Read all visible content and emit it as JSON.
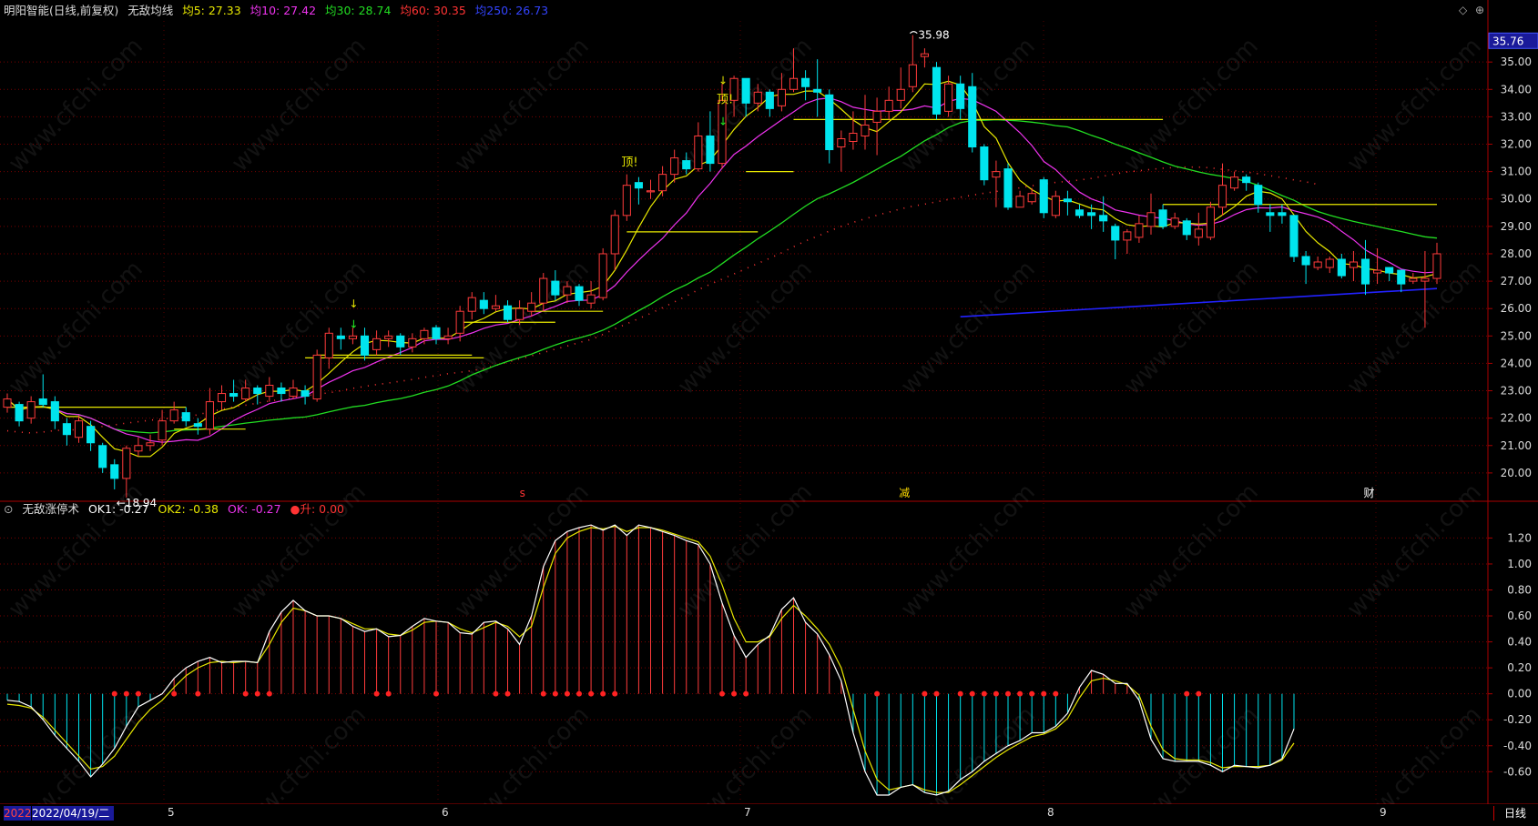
{
  "main_header": {
    "title": "明阳智能(日线,前复权)",
    "indicator": "无敌均线",
    "ma5": "均5: 27.33",
    "ma10": "均10: 27.42",
    "ma30": "均30: 28.74",
    "ma60": "均60: 30.35",
    "ma250": "均250: 26.73"
  },
  "sub_header": {
    "indicator": "无敌涨停术",
    "ok1": "OK1: -0.27",
    "ok2": "OK2: -0.38",
    "ok": "OK: -0.27",
    "rise": "●升: 0.00"
  },
  "price_axis": {
    "current_price": "35.76",
    "ticks": [
      "35.00",
      "34.00",
      "33.00",
      "32.00",
      "31.00",
      "30.00",
      "29.00",
      "28.00",
      "27.00",
      "26.00",
      "25.00",
      "24.00",
      "23.00",
      "22.00",
      "21.00",
      "20.00"
    ]
  },
  "osc_axis": {
    "ticks": [
      "1.20",
      "1.00",
      "0.80",
      "0.60",
      "0.40",
      "0.20",
      "0.00",
      "-0.20",
      "-0.40",
      "-0.60"
    ]
  },
  "annotations": {
    "high_label": "35.98",
    "low_label": "←18.94",
    "top_signal_1": "顶!",
    "top_signal_2": "顶!",
    "marker_s": "s",
    "marker_reduce": "减",
    "marker_fin": "财"
  },
  "bottom_bar": {
    "year_fragment": "2022",
    "cursor_date": "2022/04/19/二",
    "months": [
      "5",
      "6",
      "7",
      "8",
      "9"
    ],
    "period": "日线"
  },
  "watermark": "www.cfchi.com",
  "colors": {
    "up": "#ff3b3b",
    "down": "#00e5ee",
    "ma5": "#e8e800",
    "ma10": "#ee33ee",
    "ma30": "#22dd22",
    "ma60": "#ff3333",
    "ma250": "#2222ff",
    "grid": "#7a0000"
  },
  "chart_data": [
    {
      "type": "candlestick",
      "title": "明阳智能(日线,前复权)",
      "series": [
        {
          "name": "均5",
          "last": 27.33
        },
        {
          "name": "均10",
          "last": 27.42
        },
        {
          "name": "均30",
          "last": 28.74
        },
        {
          "name": "均60",
          "last": 30.35
        },
        {
          "name": "均250",
          "last": 26.73
        }
      ],
      "ylim": [
        19.0,
        36.5
      ],
      "high": 35.98,
      "low": 18.94,
      "candles": [
        [
          22.4,
          22.7,
          22.2,
          22.9
        ],
        [
          22.5,
          21.9,
          21.7,
          22.6
        ],
        [
          22.0,
          22.6,
          21.8,
          22.8
        ],
        [
          22.7,
          22.5,
          22.4,
          23.6
        ],
        [
          22.6,
          21.9,
          21.6,
          22.8
        ],
        [
          21.8,
          21.4,
          21.0,
          22.0
        ],
        [
          21.3,
          21.9,
          21.1,
          22.1
        ],
        [
          21.7,
          21.1,
          20.8,
          21.9
        ],
        [
          21.0,
          20.2,
          20.0,
          21.1
        ],
        [
          20.3,
          19.8,
          19.4,
          20.5
        ],
        [
          19.8,
          20.9,
          19.1,
          21.0
        ],
        [
          20.8,
          21.0,
          20.6,
          21.3
        ],
        [
          21.0,
          21.1,
          20.8,
          21.4
        ],
        [
          21.2,
          21.9,
          21.0,
          22.3
        ],
        [
          21.9,
          22.3,
          21.8,
          22.6
        ],
        [
          22.2,
          21.9,
          21.7,
          22.4
        ],
        [
          21.8,
          21.7,
          21.4,
          22.0
        ],
        [
          21.6,
          22.6,
          21.4,
          23.1
        ],
        [
          22.6,
          22.9,
          22.3,
          23.2
        ],
        [
          22.9,
          22.8,
          22.6,
          23.4
        ],
        [
          22.7,
          23.1,
          22.6,
          23.4
        ],
        [
          23.1,
          22.9,
          22.5,
          23.2
        ],
        [
          22.8,
          23.2,
          22.6,
          23.5
        ],
        [
          23.1,
          22.9,
          22.6,
          23.3
        ],
        [
          22.8,
          23.1,
          22.7,
          23.4
        ],
        [
          23.0,
          22.8,
          22.5,
          23.2
        ],
        [
          22.7,
          24.3,
          22.6,
          24.5
        ],
        [
          24.2,
          25.1,
          23.8,
          25.3
        ],
        [
          25.0,
          24.9,
          24.5,
          25.3
        ],
        [
          24.9,
          25.0,
          24.7,
          25.3
        ],
        [
          25.0,
          24.3,
          24.1,
          25.3
        ],
        [
          24.5,
          24.9,
          24.3,
          25.2
        ],
        [
          24.9,
          25.0,
          24.6,
          25.2
        ],
        [
          25.0,
          24.6,
          24.3,
          25.1
        ],
        [
          24.6,
          24.9,
          24.4,
          25.1
        ],
        [
          24.9,
          25.2,
          24.7,
          25.3
        ],
        [
          25.3,
          24.9,
          24.7,
          25.4
        ],
        [
          24.9,
          25.0,
          24.7,
          25.3
        ],
        [
          25.1,
          25.9,
          24.8,
          26.1
        ],
        [
          25.9,
          26.4,
          25.6,
          26.6
        ],
        [
          26.3,
          26.0,
          25.8,
          26.6
        ],
        [
          26.0,
          26.1,
          25.9,
          26.5
        ],
        [
          26.1,
          25.6,
          25.5,
          26.3
        ],
        [
          25.6,
          26.0,
          25.4,
          26.3
        ],
        [
          25.9,
          26.2,
          25.7,
          26.6
        ],
        [
          26.2,
          27.1,
          25.9,
          27.3
        ],
        [
          27.0,
          26.5,
          26.3,
          27.4
        ],
        [
          26.5,
          26.8,
          26.2,
          27.0
        ],
        [
          26.8,
          26.3,
          26.1,
          26.9
        ],
        [
          26.2,
          26.5,
          26.0,
          27.0
        ],
        [
          26.4,
          28.0,
          26.3,
          28.2
        ],
        [
          28.0,
          29.4,
          27.4,
          29.6
        ],
        [
          29.4,
          30.5,
          29.2,
          30.9
        ],
        [
          30.6,
          30.4,
          29.8,
          30.8
        ],
        [
          30.3,
          30.3,
          30.0,
          30.7
        ],
        [
          30.3,
          30.9,
          30.1,
          31.2
        ],
        [
          30.9,
          31.5,
          30.6,
          31.8
        ],
        [
          31.4,
          31.1,
          30.9,
          31.7
        ],
        [
          31.1,
          32.3,
          31.0,
          32.8
        ],
        [
          32.3,
          31.3,
          31.0,
          33.2
        ],
        [
          31.3,
          33.6,
          31.1,
          34.2
        ],
        [
          33.6,
          34.4,
          33.0,
          34.5
        ],
        [
          34.4,
          33.5,
          33.0,
          34.4
        ],
        [
          33.5,
          33.9,
          33.2,
          34.2
        ],
        [
          33.9,
          33.3,
          33.0,
          34.0
        ],
        [
          33.4,
          34.0,
          33.2,
          34.6
        ],
        [
          34.0,
          34.4,
          33.9,
          35.5
        ],
        [
          34.4,
          34.1,
          33.6,
          34.7
        ],
        [
          34.0,
          33.9,
          33.0,
          35.1
        ],
        [
          33.8,
          31.8,
          31.3,
          34.0
        ],
        [
          31.9,
          32.2,
          31.0,
          32.5
        ],
        [
          32.1,
          32.4,
          31.8,
          33.2
        ],
        [
          32.3,
          32.7,
          31.8,
          33.8
        ],
        [
          32.8,
          33.2,
          31.6,
          33.7
        ],
        [
          33.2,
          33.6,
          32.9,
          34.1
        ],
        [
          33.6,
          34.0,
          33.3,
          34.8
        ],
        [
          34.1,
          34.9,
          33.9,
          35.98
        ],
        [
          35.2,
          35.3,
          34.8,
          35.5
        ],
        [
          34.8,
          33.1,
          32.9,
          35.0
        ],
        [
          33.2,
          34.2,
          33.0,
          34.5
        ],
        [
          34.2,
          33.3,
          32.9,
          34.5
        ],
        [
          34.1,
          31.9,
          31.7,
          34.6
        ],
        [
          31.9,
          30.7,
          30.5,
          32.0
        ],
        [
          30.8,
          31.0,
          29.7,
          31.4
        ],
        [
          31.1,
          29.7,
          29.6,
          31.3
        ],
        [
          29.7,
          30.1,
          29.7,
          30.3
        ],
        [
          29.9,
          30.2,
          29.8,
          30.4
        ],
        [
          30.7,
          29.5,
          29.3,
          30.8
        ],
        [
          29.4,
          30.1,
          29.3,
          30.3
        ],
        [
          30.0,
          29.9,
          29.4,
          30.3
        ],
        [
          29.6,
          29.4,
          29.3,
          29.8
        ],
        [
          29.5,
          29.4,
          28.9,
          29.8
        ],
        [
          29.4,
          29.2,
          28.8,
          30.1
        ],
        [
          29.0,
          28.5,
          27.8,
          29.1
        ],
        [
          28.5,
          28.8,
          28.0,
          28.9
        ],
        [
          28.6,
          29.1,
          28.4,
          29.4
        ],
        [
          29.0,
          29.5,
          28.7,
          30.2
        ],
        [
          29.6,
          29.0,
          28.9,
          29.8
        ],
        [
          29.0,
          29.3,
          28.9,
          29.5
        ],
        [
          29.2,
          28.7,
          28.5,
          29.3
        ],
        [
          28.6,
          28.9,
          28.3,
          29.5
        ],
        [
          28.6,
          29.7,
          28.5,
          29.9
        ],
        [
          29.7,
          30.5,
          29.4,
          31.3
        ],
        [
          30.4,
          30.8,
          30.3,
          31.0
        ],
        [
          30.8,
          30.6,
          30.3,
          30.9
        ],
        [
          30.5,
          29.8,
          29.5,
          30.6
        ],
        [
          29.5,
          29.4,
          28.8,
          29.8
        ],
        [
          29.5,
          29.4,
          29.1,
          29.8
        ],
        [
          29.4,
          27.9,
          27.7,
          29.4
        ],
        [
          27.9,
          27.6,
          26.9,
          28.1
        ],
        [
          27.5,
          27.7,
          27.4,
          27.9
        ],
        [
          27.5,
          27.8,
          27.3,
          27.9
        ],
        [
          27.8,
          27.2,
          27.1,
          28.0
        ],
        [
          27.5,
          27.7,
          27.0,
          28.1
        ],
        [
          27.8,
          26.9,
          26.5,
          28.5
        ],
        [
          27.3,
          27.4,
          26.9,
          28.2
        ],
        [
          27.5,
          27.3,
          27.0,
          27.5
        ],
        [
          27.4,
          26.9,
          26.6,
          27.4
        ],
        [
          27.0,
          27.1,
          26.9,
          27.3
        ],
        [
          27.0,
          27.1,
          25.3,
          28.1
        ],
        [
          27.1,
          28.0,
          26.9,
          28.4
        ]
      ]
    },
    {
      "type": "line",
      "title": "无敌涨停术",
      "series": [
        {
          "name": "OK1",
          "last": -0.27
        },
        {
          "name": "OK2",
          "last": -0.38
        },
        {
          "name": "OK",
          "last": -0.27
        },
        {
          "name": "升",
          "last": 0.0
        }
      ],
      "ylim": [
        -0.85,
        1.35
      ],
      "ok": [
        -0.05,
        -0.06,
        -0.1,
        -0.2,
        -0.32,
        -0.42,
        -0.52,
        -0.64,
        -0.54,
        -0.42,
        -0.25,
        -0.1,
        -0.05,
        0.0,
        0.12,
        0.2,
        0.25,
        0.28,
        0.24,
        0.25,
        0.25,
        0.24,
        0.48,
        0.63,
        0.72,
        0.64,
        0.6,
        0.6,
        0.58,
        0.52,
        0.48,
        0.5,
        0.44,
        0.45,
        0.52,
        0.58,
        0.56,
        0.55,
        0.47,
        0.46,
        0.55,
        0.56,
        0.5,
        0.38,
        0.6,
        0.98,
        1.18,
        1.25,
        1.28,
        1.3,
        1.26,
        1.3,
        1.22,
        1.3,
        1.28,
        1.25,
        1.22,
        1.18,
        1.15,
        1.0,
        0.7,
        0.45,
        0.28,
        0.38,
        0.45,
        0.65,
        0.74,
        0.55,
        0.46,
        0.3,
        0.1,
        -0.3,
        -0.6,
        -0.78,
        -0.78,
        -0.72,
        -0.7,
        -0.76,
        -0.78,
        -0.75,
        -0.66,
        -0.6,
        -0.52,
        -0.46,
        -0.4,
        -0.36,
        -0.3,
        -0.3,
        -0.25,
        -0.15,
        0.05,
        0.18,
        0.15,
        0.08,
        0.08,
        -0.05,
        -0.35,
        -0.5,
        -0.52,
        -0.52,
        -0.52,
        -0.55,
        -0.6,
        -0.55,
        -0.56,
        -0.57,
        -0.55,
        -0.5,
        -0.27
      ],
      "ok2": [
        -0.08,
        -0.09,
        -0.11,
        -0.18,
        -0.28,
        -0.38,
        -0.48,
        -0.58,
        -0.56,
        -0.48,
        -0.35,
        -0.22,
        -0.12,
        -0.05,
        0.05,
        0.14,
        0.2,
        0.24,
        0.25,
        0.24,
        0.25,
        0.24,
        0.38,
        0.55,
        0.66,
        0.64,
        0.6,
        0.6,
        0.58,
        0.54,
        0.5,
        0.5,
        0.46,
        0.45,
        0.49,
        0.55,
        0.56,
        0.55,
        0.5,
        0.47,
        0.51,
        0.55,
        0.52,
        0.44,
        0.52,
        0.82,
        1.08,
        1.2,
        1.25,
        1.28,
        1.27,
        1.29,
        1.25,
        1.28,
        1.28,
        1.26,
        1.23,
        1.2,
        1.17,
        1.06,
        0.84,
        0.58,
        0.4,
        0.4,
        0.44,
        0.58,
        0.68,
        0.6,
        0.5,
        0.38,
        0.2,
        -0.12,
        -0.44,
        -0.66,
        -0.74,
        -0.72,
        -0.7,
        -0.74,
        -0.76,
        -0.76,
        -0.7,
        -0.63,
        -0.56,
        -0.49,
        -0.43,
        -0.38,
        -0.33,
        -0.31,
        -0.27,
        -0.19,
        -0.03,
        0.1,
        0.12,
        0.1,
        0.07,
        -0.01,
        -0.25,
        -0.43,
        -0.5,
        -0.51,
        -0.51,
        -0.53,
        -0.57,
        -0.56,
        -0.56,
        -0.56,
        -0.55,
        -0.51,
        -0.38
      ],
      "dots": [
        9,
        10,
        11,
        14,
        16,
        20,
        21,
        22,
        31,
        32,
        36,
        41,
        42,
        45,
        46,
        47,
        48,
        49,
        50,
        51,
        60,
        61,
        62,
        73,
        77,
        78,
        80,
        81,
        82,
        83,
        84,
        85,
        86,
        87,
        88,
        99,
        100
      ]
    }
  ]
}
